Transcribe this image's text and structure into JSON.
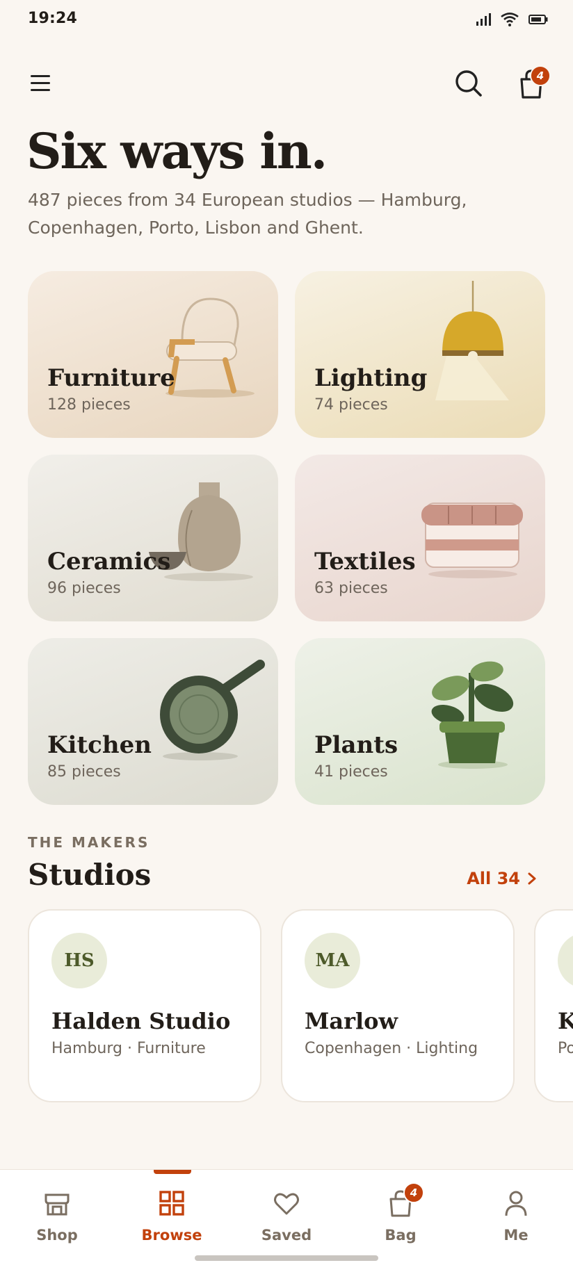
{
  "status_bar": {
    "time": "19:24"
  },
  "header": {
    "cart_count": "4"
  },
  "hero": {
    "title": "Six ways in.",
    "subtitle": "487 pieces from 34 European studios — Hamburg, Copenhagen, Porto, Lisbon and Ghent."
  },
  "categories": [
    {
      "name": "Furniture",
      "count": "128 pieces",
      "icon": "chair-illustration"
    },
    {
      "name": "Lighting",
      "count": "74 pieces",
      "icon": "pendant-lamp-illustration"
    },
    {
      "name": "Ceramics",
      "count": "96 pieces",
      "icon": "vase-illustration"
    },
    {
      "name": "Textiles",
      "count": "63 pieces",
      "icon": "folded-blanket-illustration"
    },
    {
      "name": "Kitchen",
      "count": "85 pieces",
      "icon": "pan-illustration"
    },
    {
      "name": "Plants",
      "count": "41 pieces",
      "icon": "potted-plant-illustration"
    }
  ],
  "makers": {
    "eyebrow": "THE MAKERS",
    "title": "Studios",
    "see_all": "All 34",
    "studios": [
      {
        "initials": "HS",
        "name": "Halden Studio",
        "meta": "Hamburg · Furniture"
      },
      {
        "initials": "MA",
        "name": "Marlow",
        "meta": "Copenhagen · Lighting"
      },
      {
        "initials": "",
        "name": "K",
        "meta": "Po"
      }
    ]
  },
  "bottom_nav": {
    "items": [
      {
        "label": "Shop",
        "icon": "storefront-icon"
      },
      {
        "label": "Browse",
        "icon": "grid-icon",
        "active": true
      },
      {
        "label": "Saved",
        "icon": "heart-icon"
      },
      {
        "label": "Bag",
        "icon": "bag-icon",
        "badge": "4"
      },
      {
        "label": "Me",
        "icon": "person-icon"
      }
    ]
  },
  "colors": {
    "accent": "#c2410c",
    "background": "#faf6f1",
    "text": "#221d18",
    "muted": "#6e655b"
  }
}
